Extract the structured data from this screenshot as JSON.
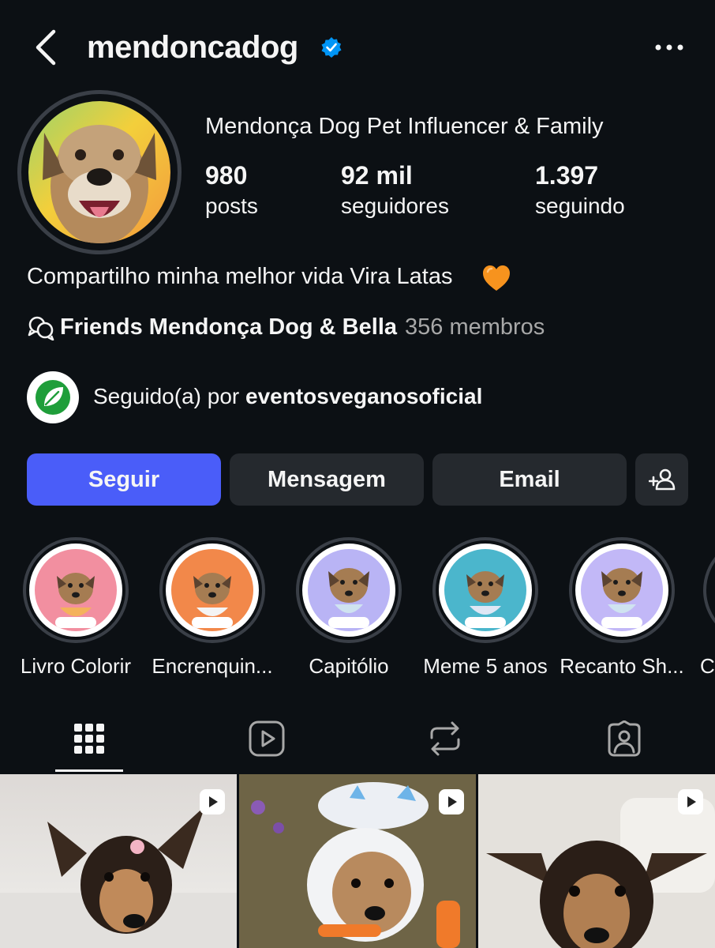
{
  "header": {
    "username": "mendoncadog",
    "back_icon": "chevron-left-icon",
    "verified_icon": "verified-badge-icon",
    "more_icon": "more-horizontal-icon"
  },
  "profile": {
    "display_name": "Mendonça Dog Pet Influencer & Family",
    "stats": [
      {
        "value": "980",
        "label": "posts"
      },
      {
        "value": "92 mil",
        "label": "seguidores"
      },
      {
        "value": "1.397",
        "label": "seguindo"
      }
    ],
    "bio": "Compartilho minha melhor vida Vira Latas",
    "bio_emoji": "orange-heart-icon",
    "channel": {
      "name": "Friends Mendonça Dog & Bella",
      "members": "356 membros"
    },
    "followed_by": {
      "prefix": "Seguido(a) por ",
      "account": "eventosveganosoficial"
    }
  },
  "actions": {
    "follow": "Seguir",
    "message": "Mensagem",
    "email": "Email",
    "add_user_icon": "add-person-icon"
  },
  "highlights": [
    {
      "label": "Livro Colorir",
      "color": "#f28fa0"
    },
    {
      "label": "Encrenquin...",
      "color": "#f2884a"
    },
    {
      "label": "Capitólio",
      "color": "#b9b4f5"
    },
    {
      "label": "Meme 5 anos",
      "color": "#4bb6cc"
    },
    {
      "label": "Recanto Sh...",
      "color": "#c2b8f7"
    },
    {
      "label": "C",
      "color": "#6d6d6d"
    }
  ],
  "tabs": [
    "grid-icon",
    "reels-icon",
    "reposts-icon",
    "tagged-icon"
  ],
  "colors": {
    "background": "#0c1014",
    "primary_button": "#4a5df9",
    "secondary_button": "#25292e",
    "verified": "#0095f6"
  }
}
